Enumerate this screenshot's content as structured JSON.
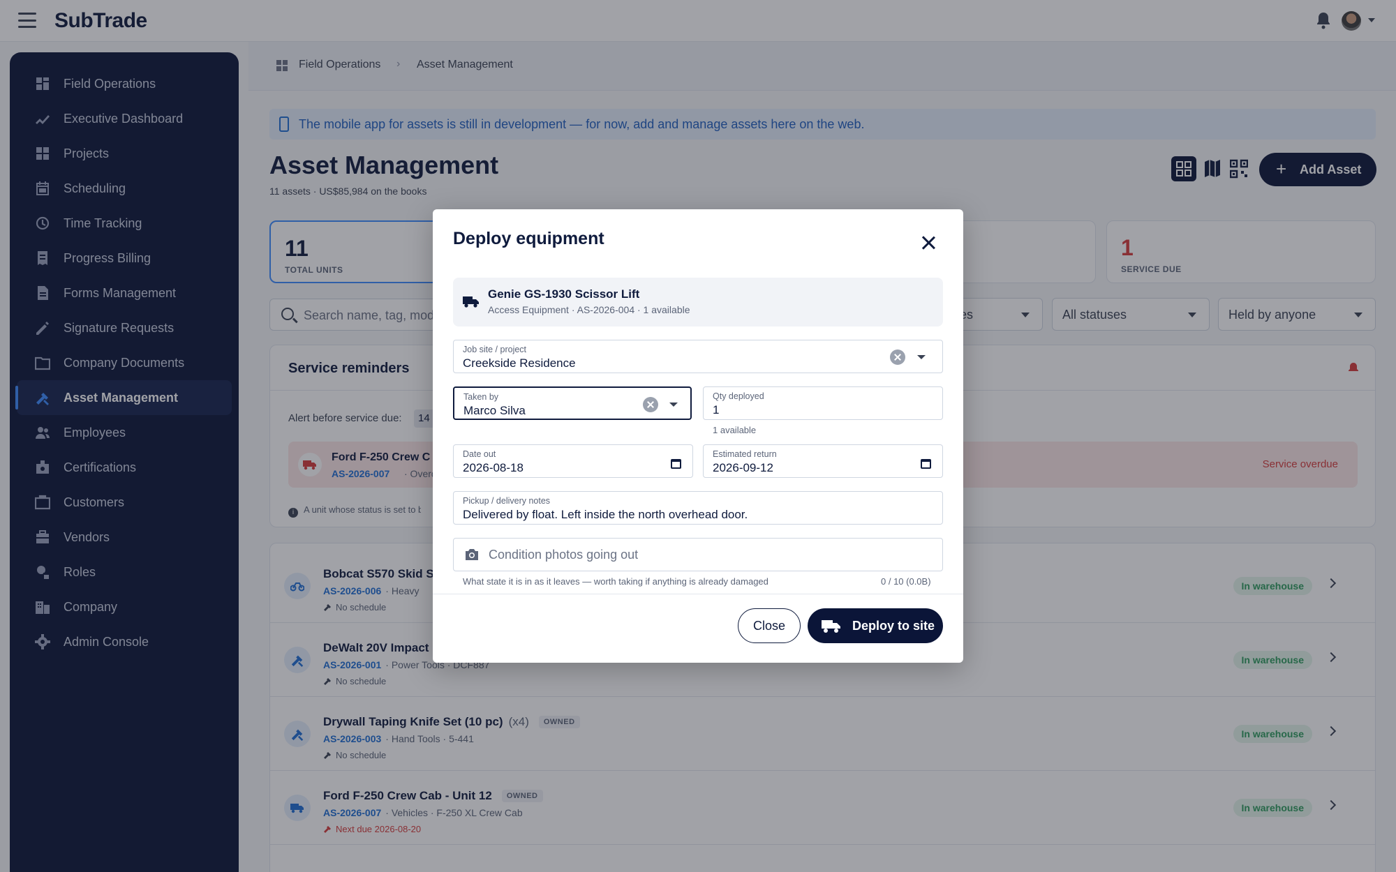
{
  "app": {
    "brand": "SubTrade"
  },
  "sidebar": {
    "items": [
      {
        "label": "Field Operations",
        "icon": "dashboard-icon"
      },
      {
        "label": "Executive Dashboard",
        "icon": "trend-icon"
      },
      {
        "label": "Projects",
        "icon": "grid-icon"
      },
      {
        "label": "Scheduling",
        "icon": "calendar-icon"
      },
      {
        "label": "Time Tracking",
        "icon": "history-icon"
      },
      {
        "label": "Progress Billing",
        "icon": "receipt-icon"
      },
      {
        "label": "Forms Management",
        "icon": "form-icon"
      },
      {
        "label": "Signature Requests",
        "icon": "signature-icon"
      },
      {
        "label": "Company Documents",
        "icon": "folder-icon"
      },
      {
        "label": "Asset Management",
        "icon": "tools-icon",
        "active": true
      },
      {
        "label": "Employees",
        "icon": "people-icon"
      },
      {
        "label": "Certifications",
        "icon": "badge-icon"
      },
      {
        "label": "Customers",
        "icon": "briefcase-icon"
      },
      {
        "label": "Vendors",
        "icon": "vendor-icon"
      },
      {
        "label": "Roles",
        "icon": "role-icon"
      },
      {
        "label": "Company",
        "icon": "building-icon"
      },
      {
        "label": "Admin Console",
        "icon": "gear-icon"
      }
    ]
  },
  "breadcrumb": {
    "parent": "Field Operations",
    "separator": "›",
    "current": "Asset Management"
  },
  "banner": {
    "text": "The mobile app for assets is still in development — for now, add and manage assets here on the web."
  },
  "page": {
    "title": "Asset Management",
    "subtitle": "11 assets · US$85,984 on the books",
    "add_button": "Add Asset",
    "add_plus": "+"
  },
  "stats": [
    {
      "value": "11",
      "label": "TOTAL UNITS"
    },
    {
      "value": "1",
      "label": "SERVICE DUE"
    }
  ],
  "filters": {
    "search_placeholder": "Search name, tag, mod",
    "category_partial": "es",
    "status": "All statuses",
    "held_by": "Held by anyone"
  },
  "reminders": {
    "title": "Service reminders",
    "alert_label": "Alert before service due:",
    "alert_value": "14",
    "row": {
      "name": "Ford F-250 Crew C",
      "tag": "AS-2026-007",
      "tag_suffix": "· Overdu",
      "status": "Service overdue"
    },
    "note": "A unit whose status is set to b",
    "note_icon": "i"
  },
  "assets": [
    {
      "name": "Bobcat S570 Skid S",
      "count": "",
      "owned": "",
      "tag": "AS-2026-006",
      "meta": "· Heavy",
      "schedule": "No schedule",
      "status": "In warehouse",
      "icon": "bike-icon"
    },
    {
      "name": "DeWalt 20V Impact",
      "count": "",
      "owned": "",
      "tag": "AS-2026-001",
      "meta": "· Power Tools · DCF887",
      "schedule": "No schedule",
      "status": "In warehouse",
      "icon": "tools-icon"
    },
    {
      "name": "Drywall Taping Knife Set (10 pc)",
      "count": "(x4)",
      "owned": "OWNED",
      "tag": "AS-2026-003",
      "meta": "· Hand Tools · 5-441",
      "schedule": "No schedule",
      "status": "In warehouse",
      "icon": "tools-icon"
    },
    {
      "name": "Ford F-250 Crew Cab - Unit 12",
      "count": "",
      "owned": "OWNED",
      "tag": "AS-2026-007",
      "meta": "· Vehicles · F-250 XL Crew Cab",
      "schedule": "Next due 2026-08-20",
      "status": "In warehouse",
      "icon": "truck-icon",
      "schedule_alert": true
    }
  ],
  "modal": {
    "title": "Deploy equipment",
    "equipment": {
      "name": "Genie GS-1930 Scissor Lift",
      "sub": "Access Equipment · AS-2026-004 · 1 available"
    },
    "job_site": {
      "label": "Job site / project",
      "value": "Creekside Residence"
    },
    "taken_by": {
      "label": "Taken by",
      "value": "Marco Silva"
    },
    "qty": {
      "label": "Qty deployed",
      "value": "1",
      "helper": "1 available"
    },
    "date_out": {
      "label": "Date out",
      "value": "2026-08-18"
    },
    "est_return": {
      "label": "Estimated return",
      "value": "2026-09-12"
    },
    "notes": {
      "label": "Pickup / delivery notes",
      "value": "Delivered by float. Left inside the north overhead door."
    },
    "photos": {
      "placeholder": "Condition photos going out",
      "helper": "What state it is in as it leaves — worth taking if anything is already damaged",
      "count": "0 / 10 (0.0B)"
    },
    "close_label": "Close",
    "deploy_label": "Deploy to site"
  },
  "colors": {
    "navy": "#0b1538",
    "accent": "#3d8cff",
    "link": "#1f6ed4",
    "danger": "#d63b3b",
    "success": "#2e9b5d"
  }
}
